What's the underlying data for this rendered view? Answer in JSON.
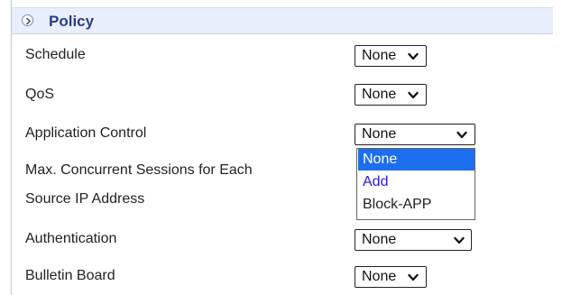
{
  "section": {
    "title": "Policy",
    "icon": "expand-circle-icon"
  },
  "fields": [
    {
      "label": "Schedule",
      "value": "None"
    },
    {
      "label": "QoS",
      "value": "None"
    },
    {
      "label": "Application Control",
      "value": "None"
    },
    {
      "label_line1": "Max. Concurrent Sessions for Each",
      "label_line2": "Source IP Address"
    },
    {
      "label": "Authentication",
      "value": "None"
    },
    {
      "label": "Bulletin Board",
      "value": "None"
    }
  ],
  "application_control_dropdown": {
    "options": [
      "None",
      "Add",
      "Block-APP"
    ],
    "selected": "None"
  },
  "colors": {
    "header_bg": "#e8eefb",
    "header_text": "#2b3f88",
    "selected_option": "#1e6ff0",
    "link_option": "#2b16e8"
  }
}
